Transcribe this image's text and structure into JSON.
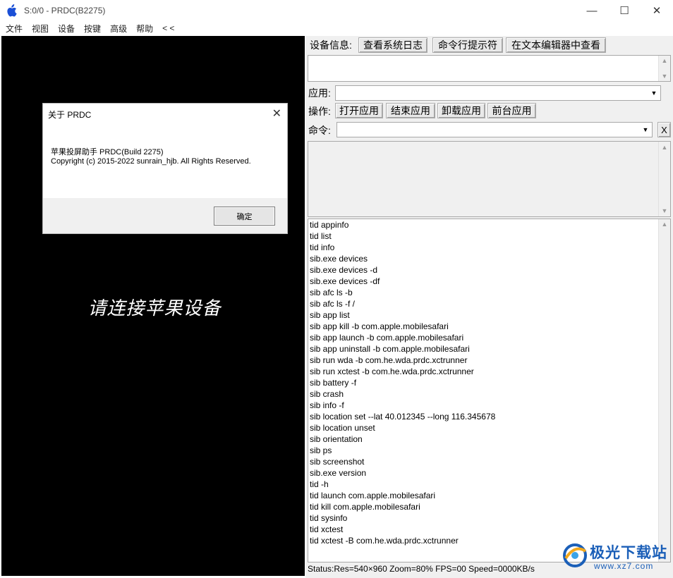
{
  "window": {
    "title": "S:0/0 - PRDC(B2275)",
    "min_glyph": "—",
    "max_glyph": "☐",
    "close_glyph": "✕"
  },
  "menu": [
    "文件",
    "视图",
    "设备",
    "按键",
    "高级",
    "帮助",
    "< <"
  ],
  "screen": {
    "message": "请连接苹果设备"
  },
  "about_dialog": {
    "title": "关于 PRDC",
    "close_glyph": "✕",
    "line1": "苹果投屏助手 PRDC(Build 2275)",
    "line2": "Copyright (c) 2015-2022 sunrain_hjb. All Rights Reserved.",
    "ok_label": "确定"
  },
  "panel": {
    "device_info_label": "设备信息:",
    "view_syslog": "查看系统日志",
    "cmd_prompt": "命令行提示符",
    "view_in_editor": "在文本编辑器中查看",
    "app_label": "应用:",
    "app_value": "",
    "ops_label": "操作:",
    "open_app": "打开应用",
    "close_app": "结束应用",
    "uninstall_app": "卸载应用",
    "foreground_app": "前台应用",
    "cmd_label": "命令:",
    "cmd_value": "",
    "clear_label": "X",
    "scroll_up": "▲",
    "scroll_down": "▼",
    "combo_arrow": "▼"
  },
  "log_lines": [
    "tid appinfo",
    "tid list",
    "tid info",
    "sib.exe devices",
    "sib.exe devices -d",
    "sib.exe devices -df",
    "sib afc ls -b",
    "sib afc ls -f /",
    "sib app list",
    "sib app kill -b com.apple.mobilesafari",
    "sib app launch -b com.apple.mobilesafari",
    "sib app uninstall -b com.apple.mobilesafari",
    "sib run wda -b com.he.wda.prdc.xctrunner",
    "sib run xctest -b com.he.wda.prdc.xctrunner",
    "sib battery -f",
    "sib crash",
    "sib info -f",
    "sib location set --lat 40.012345  --long 116.345678",
    "sib location unset",
    "sib orientation",
    "sib ps",
    "sib screenshot",
    "sib.exe version",
    "tid -h",
    "tid launch com.apple.mobilesafari",
    "tid kill com.apple.mobilesafari",
    "tid sysinfo",
    "tid xctest",
    "tid xctest -B com.he.wda.prdc.xctrunner"
  ],
  "status": "Status:Res=540×960 Zoom=80% FPS=00 Speed=0000KB/s",
  "watermark": {
    "name": "极光下载站",
    "url": "www.xz7.com"
  },
  "colors": {
    "screen_bg": "#000000",
    "panel_bg": "#f0f0f0",
    "watermark": "#1b5fb8",
    "apple_icon": "#1a4fd6"
  }
}
